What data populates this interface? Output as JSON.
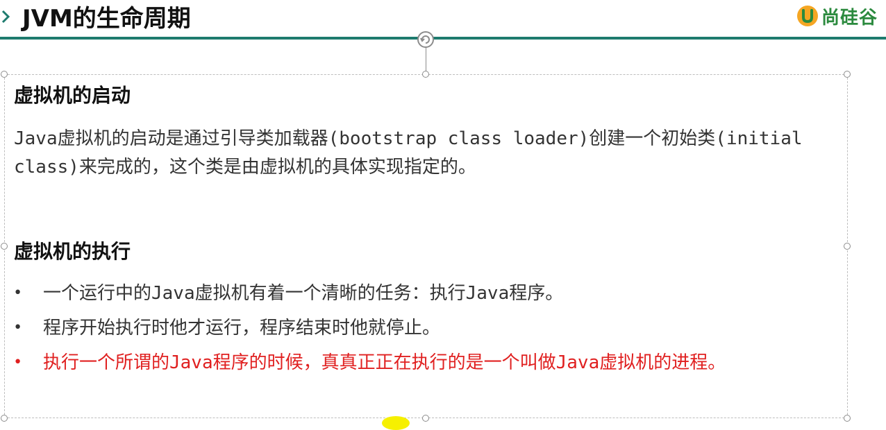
{
  "slide": {
    "title": "JVM的生命周期",
    "brand": "尚硅谷"
  },
  "section1": {
    "heading": "虚拟机的启动",
    "paragraph": "Java虚拟机的启动是通过引导类加载器(bootstrap class loader)创建一个初始类(initial class)来完成的，这个类是由虚拟机的具体实现指定的。"
  },
  "section2": {
    "heading": "虚拟机的执行",
    "bullets": [
      "一个运行中的Java虚拟机有着一个清晰的任务：执行Java程序。",
      "程序开始执行时他才运行，程序结束时他就停止。",
      "执行一个所谓的Java程序的时候，真真正正在执行的是一个叫做Java虚拟机的进程。"
    ],
    "bullet_marker": "•"
  },
  "colors": {
    "accent_rule": "#1e7b6e",
    "brand_green": "#2b8a3e",
    "highlight_red": "#e02020"
  },
  "icons": {
    "header_arrow": "chevron-right-icon",
    "brand_logo": "brand-u-logo-icon",
    "rotate_handle": "rotate-icon"
  }
}
